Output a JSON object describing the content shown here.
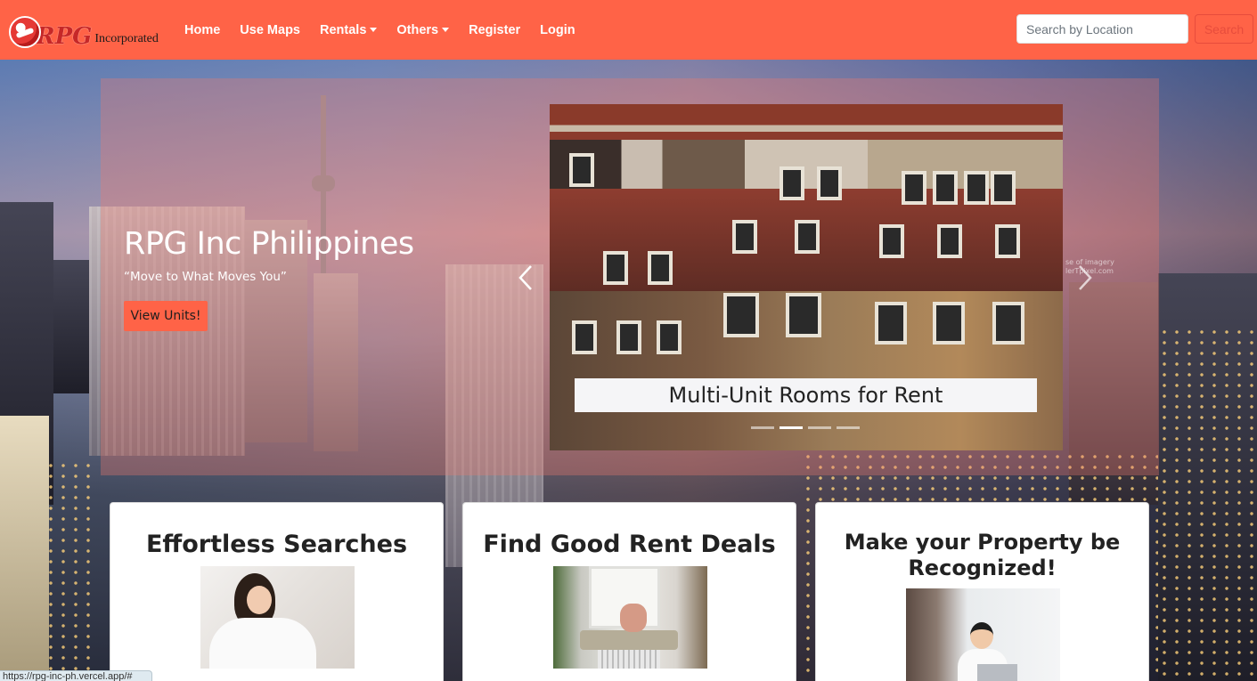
{
  "brand": {
    "logo_text": "RPG",
    "suffix": "Incorporated"
  },
  "nav": {
    "items": [
      {
        "label": "Home"
      },
      {
        "label": "Use Maps"
      },
      {
        "label": "Rentals"
      },
      {
        "label": "Others"
      },
      {
        "label": "Register"
      },
      {
        "label": "Login"
      }
    ]
  },
  "search": {
    "placeholder": "Search by Location",
    "button_label": "Search"
  },
  "hero": {
    "title": "RPG Inc Philippines",
    "tagline": "“Move to What Moves You”",
    "cta_label": "View Units!"
  },
  "carousel": {
    "caption": "Multi-Unit Rooms for Rent",
    "watermark": "se of imagery\nlerTpixel.com",
    "slide_count": 4,
    "active_index": 1
  },
  "cards": [
    {
      "title": "Effortless Searches"
    },
    {
      "title": "Find Good Rent Deals"
    },
    {
      "title": "Make your Property be Recognized!"
    }
  ],
  "status_bar": {
    "url": "https://rpg-inc-ph.vercel.app/#"
  },
  "colors": {
    "navbar": "#ff6347",
    "accent": "#ff6347",
    "search_button": "#e74c3c"
  }
}
